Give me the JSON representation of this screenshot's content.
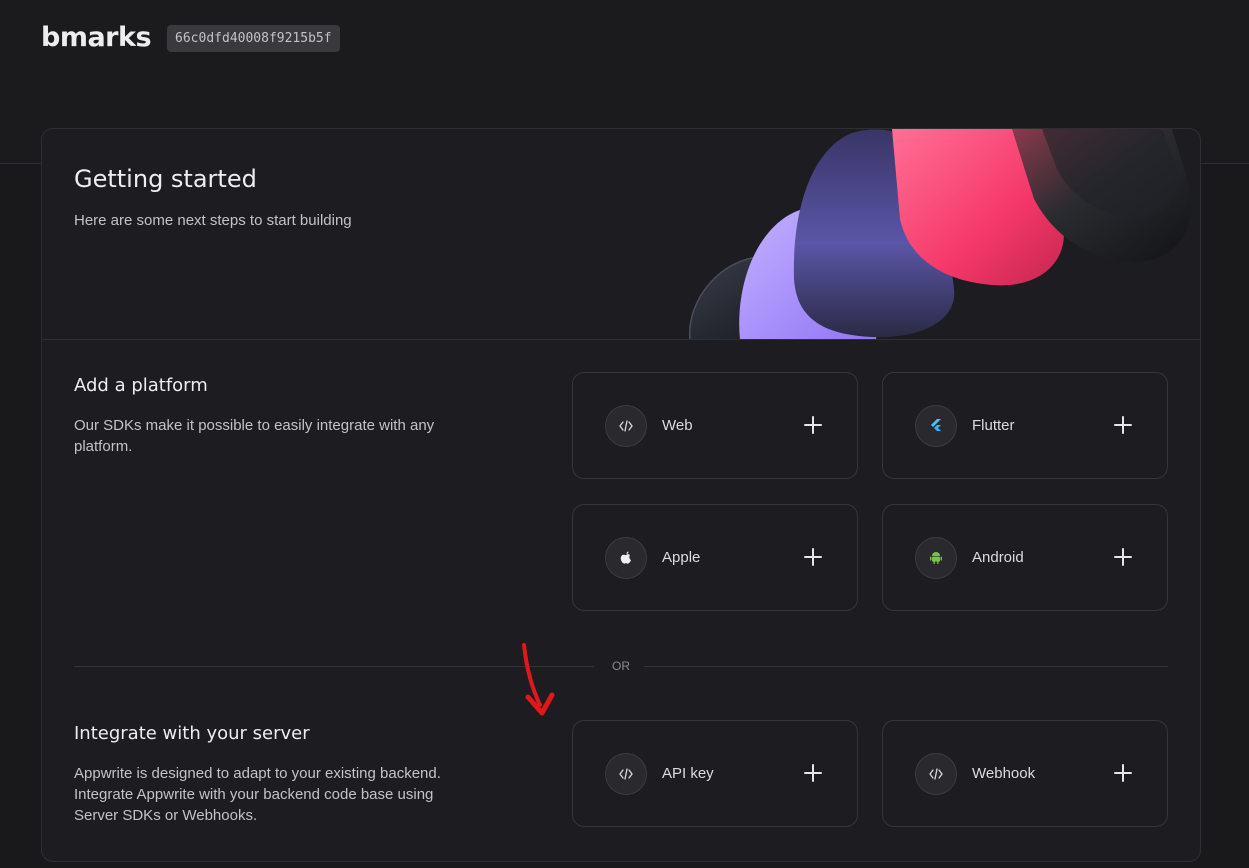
{
  "header": {
    "project_name": "bmarks",
    "project_id": "66c0dfd40008f9215b5f"
  },
  "hero": {
    "title": "Getting started",
    "subtitle": "Here are some next steps to start building"
  },
  "platform": {
    "title": "Add a platform",
    "description": "Our SDKs make it possible to easily integrate with any platform.",
    "tiles": [
      {
        "label": "Web",
        "icon": "code-icon"
      },
      {
        "label": "Flutter",
        "icon": "flutter-icon"
      },
      {
        "label": "Apple",
        "icon": "apple-icon"
      },
      {
        "label": "Android",
        "icon": "android-icon"
      }
    ]
  },
  "divider": {
    "label": "OR"
  },
  "server": {
    "title": "Integrate with your server",
    "description": "Appwrite is designed to adapt to your existing backend. Integrate Appwrite with your backend code base using Server SDKs or Webhooks.",
    "tiles": [
      {
        "label": "API key",
        "icon": "code-icon"
      },
      {
        "label": "Webhook",
        "icon": "code-icon"
      }
    ]
  },
  "colors": {
    "background": "#19191c",
    "card": "#1d1d21",
    "accent_pink": "#fd366e",
    "accent_purple": "#a78bfa",
    "annotation_arrow": "#e0181b"
  }
}
